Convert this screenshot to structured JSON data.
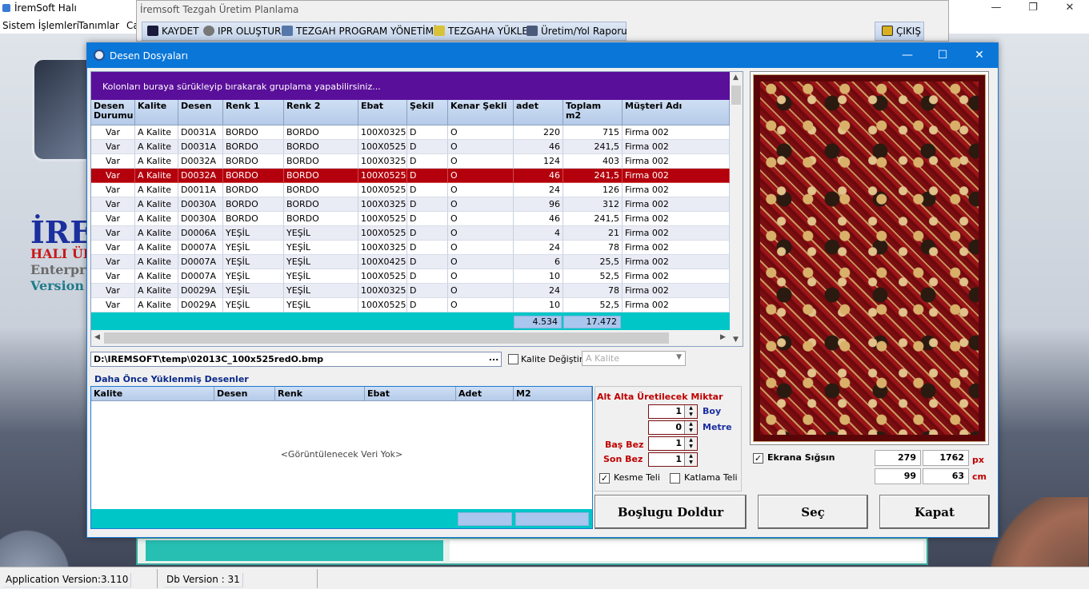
{
  "app": {
    "title": "İremSoft Halı",
    "menu": [
      "Sistem İşlemleri",
      "Tanımlar",
      "Ca"
    ],
    "brand": {
      "line1": "İRE",
      "line2": "HALI ÜR",
      "line3": "Enterpri",
      "line4": "Version :"
    }
  },
  "tezgah": {
    "title": "İremsoft Tezgah Üretim Planlama",
    "toolbar": {
      "kaydet": "KAYDET",
      "ipr": "IPR OLUŞTUR",
      "tezgah_prog": "TEZGAH PROGRAM YÖNETİMİ",
      "tezgaha_yukle": "TEZGAHA YÜKLE",
      "rapor": "Üretim/Yol Raporu",
      "cikis": "ÇIKIŞ"
    }
  },
  "status": {
    "app_version": "Application Version:3.110",
    "db_version": "Db Version : 31"
  },
  "dialog": {
    "title": "Desen Dosyaları",
    "group_hint": "Kolonları buraya sürükleyip bırakarak gruplama yapabilirsiniz...",
    "columns": [
      "Desen Durumu",
      "Kalite",
      "Desen",
      "Renk 1",
      "Renk 2",
      "Ebat",
      "Şekil",
      "Kenar Şekli",
      "adet",
      "Toplam m2",
      "Müşteri Adı"
    ],
    "rows": [
      [
        "Var",
        "A Kalite",
        "D0031A",
        "BORDO",
        "BORDO",
        "100X0325",
        "D",
        "O",
        "220",
        "715",
        "Firma 002"
      ],
      [
        "Var",
        "A Kalite",
        "D0031A",
        "BORDO",
        "BORDO",
        "100X0525",
        "D",
        "O",
        "46",
        "241,5",
        "Firma 002"
      ],
      [
        "Var",
        "A Kalite",
        "D0032A",
        "BORDO",
        "BORDO",
        "100X0325",
        "D",
        "O",
        "124",
        "403",
        "Firma 002"
      ],
      [
        "Var",
        "A Kalite",
        "D0032A",
        "BORDO",
        "BORDO",
        "100X0525",
        "D",
        "O",
        "46",
        "241,5",
        "Firma 002"
      ],
      [
        "Var",
        "A Kalite",
        "D0011A",
        "BORDO",
        "BORDO",
        "100X0525",
        "D",
        "O",
        "24",
        "126",
        "Firma 002"
      ],
      [
        "Var",
        "A Kalite",
        "D0030A",
        "BORDO",
        "BORDO",
        "100X0325",
        "D",
        "O",
        "96",
        "312",
        "Firma 002"
      ],
      [
        "Var",
        "A Kalite",
        "D0030A",
        "BORDO",
        "BORDO",
        "100X0525",
        "D",
        "O",
        "46",
        "241,5",
        "Firma 002"
      ],
      [
        "Var",
        "A Kalite",
        "D0006A",
        "YEŞİL",
        "YEŞİL",
        "100X0525",
        "D",
        "O",
        "4",
        "21",
        "Firma 002"
      ],
      [
        "Var",
        "A Kalite",
        "D0007A",
        "YEŞİL",
        "YEŞİL",
        "100X0325",
        "D",
        "O",
        "24",
        "78",
        "Firma 002"
      ],
      [
        "Var",
        "A Kalite",
        "D0007A",
        "YEŞİL",
        "YEŞİL",
        "100X0425",
        "D",
        "O",
        "6",
        "25,5",
        "Firma 002"
      ],
      [
        "Var",
        "A Kalite",
        "D0007A",
        "YEŞİL",
        "YEŞİL",
        "100X0525",
        "D",
        "O",
        "10",
        "52,5",
        "Firma 002"
      ],
      [
        "Var",
        "A Kalite",
        "D0029A",
        "YEŞİL",
        "YEŞİL",
        "100X0325",
        "D",
        "O",
        "24",
        "78",
        "Firma 002"
      ],
      [
        "Var",
        "A Kalite",
        "D0029A",
        "YEŞİL",
        "YEŞİL",
        "100X0525",
        "D",
        "O",
        "10",
        "52,5",
        "Firma 002"
      ]
    ],
    "selected_row": 3,
    "totals": {
      "adet": "4.534",
      "m2": "17.472"
    },
    "path": "D:\\IREMSOFT\\temp\\02013C_100x525redO.bmp",
    "path_btn": "...",
    "kalite_degistir": "Kalite Değiştir",
    "kalite_select": "A Kalite",
    "previous_title": "Daha Önce Yüklenmiş Desenler",
    "prev_columns": [
      "Kalite",
      "Desen",
      "Renk",
      "Ebat",
      "Adet",
      "M2"
    ],
    "no_data": "<Görüntülenecek Veri Yok>",
    "alt_alta": {
      "title": "Alt Alta Üretilecek Miktar",
      "boy_val": "1",
      "boy_lbl": "Boy",
      "metre_val": "0",
      "metre_lbl": "Metre",
      "bas_bez_lbl": "Baş Bez",
      "bas_bez_val": "1",
      "son_bez_lbl": "Son Bez",
      "son_bez_val": "1"
    },
    "kesme_teli": "Kesme Teli",
    "katlama_teli": "Katlama Teli",
    "ekrana_sigsin": "Ekrana Sığsın",
    "px": {
      "w": "279",
      "h": "1762",
      "unit": "px"
    },
    "cm": {
      "w": "99",
      "h": "63",
      "unit": "cm"
    },
    "buttons": {
      "bosluk": "Boşlugu Doldur",
      "sec": "Seç",
      "kapat": "Kapat"
    }
  }
}
